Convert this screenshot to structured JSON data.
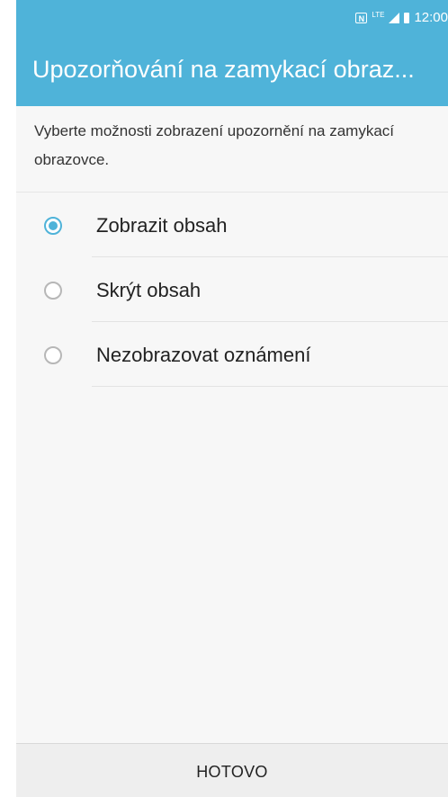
{
  "status_bar": {
    "nfc_icon": "nfc-icon",
    "network": "LTE",
    "time": "12:00"
  },
  "header": {
    "title": "Upozorňování na zamykací obraz..."
  },
  "main": {
    "description": "Vyberte možnosti zobrazení upozornění na zamykací obrazovce.",
    "options": [
      {
        "label": "Zobrazit obsah",
        "selected": true
      },
      {
        "label": "Skrýt obsah",
        "selected": false
      },
      {
        "label": "Nezobrazovat oznámení",
        "selected": false
      }
    ]
  },
  "footer": {
    "done_label": "HOTOVO"
  },
  "colors": {
    "accent": "#4fb3d9",
    "background": "#f7f7f7",
    "bottom_bar": "#eeeeee"
  }
}
